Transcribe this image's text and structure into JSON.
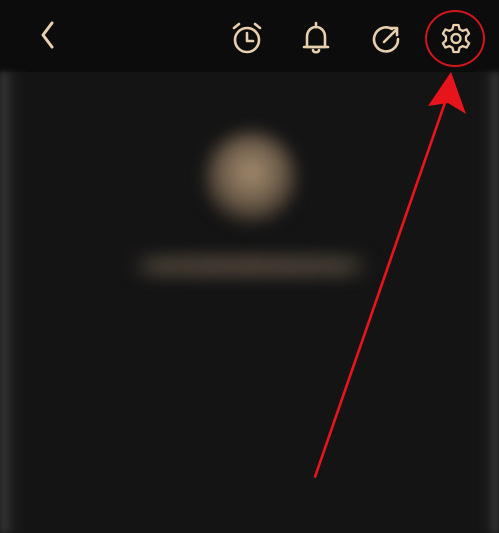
{
  "toolbar": {
    "back_icon": "chevron-left-icon",
    "alarm_icon": "alarm-clock-icon",
    "bell_icon": "bell-icon",
    "share_icon": "share-arrow-icon",
    "settings_icon": "gear-icon"
  },
  "colors": {
    "background": "#121212",
    "topbar": "#0c0c0c",
    "icon_tint": "#e8cfae",
    "annotation_red": "#e8141b"
  },
  "annotation": {
    "highlight_target": "settings-button",
    "shape": "circle-and-arrow"
  }
}
